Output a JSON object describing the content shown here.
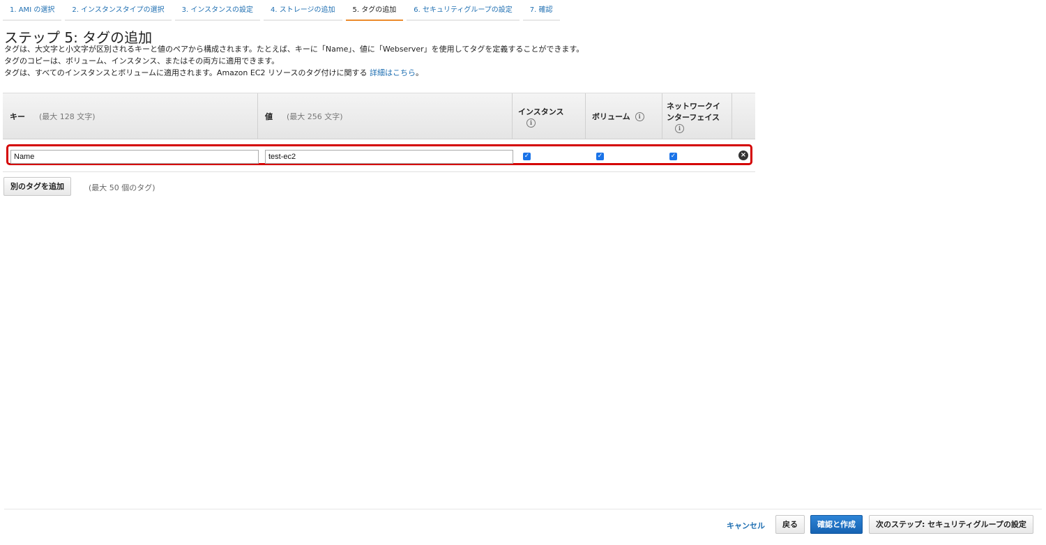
{
  "tabs": [
    {
      "label": "1. AMI の選択"
    },
    {
      "label": "2. インスタンスタイプの選択"
    },
    {
      "label": "3. インスタンスの設定"
    },
    {
      "label": "4. ストレージの追加"
    },
    {
      "label": "5. タグの追加"
    },
    {
      "label": "6. セキュリティグループの設定"
    },
    {
      "label": "7. 確認"
    }
  ],
  "active_tab_color": "#ec8b2c",
  "page": {
    "title": "ステップ 5: タグの追加",
    "desc1": "タグは、大文字と小文字が区別されるキーと値のペアから構成されます。たとえば、キーに「Name」、値に「Webserver」を使用してタグを定義することができます。",
    "desc2": "タグのコピーは、ボリューム、インスタンス、またはその両方に適用できます。",
    "desc3": "タグは、すべてのインスタンスとボリュームに適用されます。Amazon EC2 リソースのタグ付けに関する",
    "desc3_link": "詳細はこちら",
    "desc3_end": "。"
  },
  "table": {
    "headers": {
      "key": "キー",
      "key_hint": "(最大 128 文字)",
      "value": "値",
      "value_hint": "(最大 256 文字)",
      "instance": "インスタンス",
      "volume": "ボリューム",
      "nic_line1": "ネットワークイ",
      "nic_line2": "ンターフェイス",
      "info_glyph": "i"
    },
    "rows": [
      {
        "key": "Name",
        "value": "test-ec2",
        "instance": true,
        "volume": true,
        "nic": true
      }
    ],
    "highlight_color": "#d40000"
  },
  "add_tag": {
    "button": "別のタグを追加",
    "hint": "(最大 50 個のタグ)"
  },
  "footer": {
    "cancel": "キャンセル",
    "back": "戻る",
    "review": "確認と作成",
    "next": "次のステップ: セキュリティグループの設定"
  },
  "icons": {
    "check": "✓",
    "remove": "×"
  }
}
